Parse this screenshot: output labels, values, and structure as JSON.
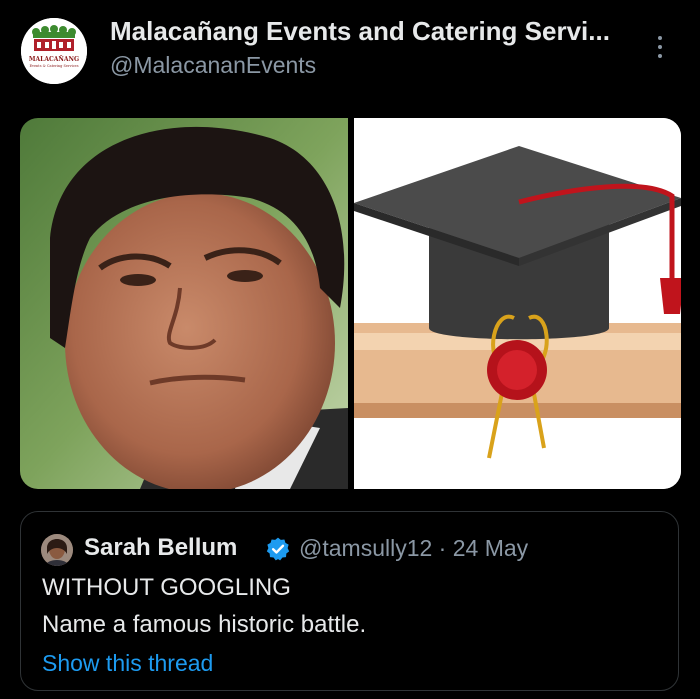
{
  "account": {
    "name": "Malacañang Events and Catering Servi...",
    "handle": "@MalacananEvents",
    "logo_text": "MALACAÑANG",
    "logo_subtext": "Events & Catering Services"
  },
  "menu": {
    "icon": "more-vertical-icon"
  },
  "media": {
    "left": {
      "description": "portrait"
    },
    "right": {
      "description": "graduation-cap-and-diploma"
    }
  },
  "quoted_tweet": {
    "author_name": "Sarah Bellum",
    "verified_icon": "verified-badge-icon",
    "meta": "@tamsully12 · 24 May",
    "line1": "WITHOUT GOOGLING",
    "line2": "Name a famous historic battle.",
    "show_thread": "Show this thread"
  },
  "colors": {
    "background": "#000000",
    "primary_text": "#e7e9ea",
    "secondary_text": "#8b98a5",
    "link": "#1d9bf0",
    "border": "#2f3336"
  }
}
